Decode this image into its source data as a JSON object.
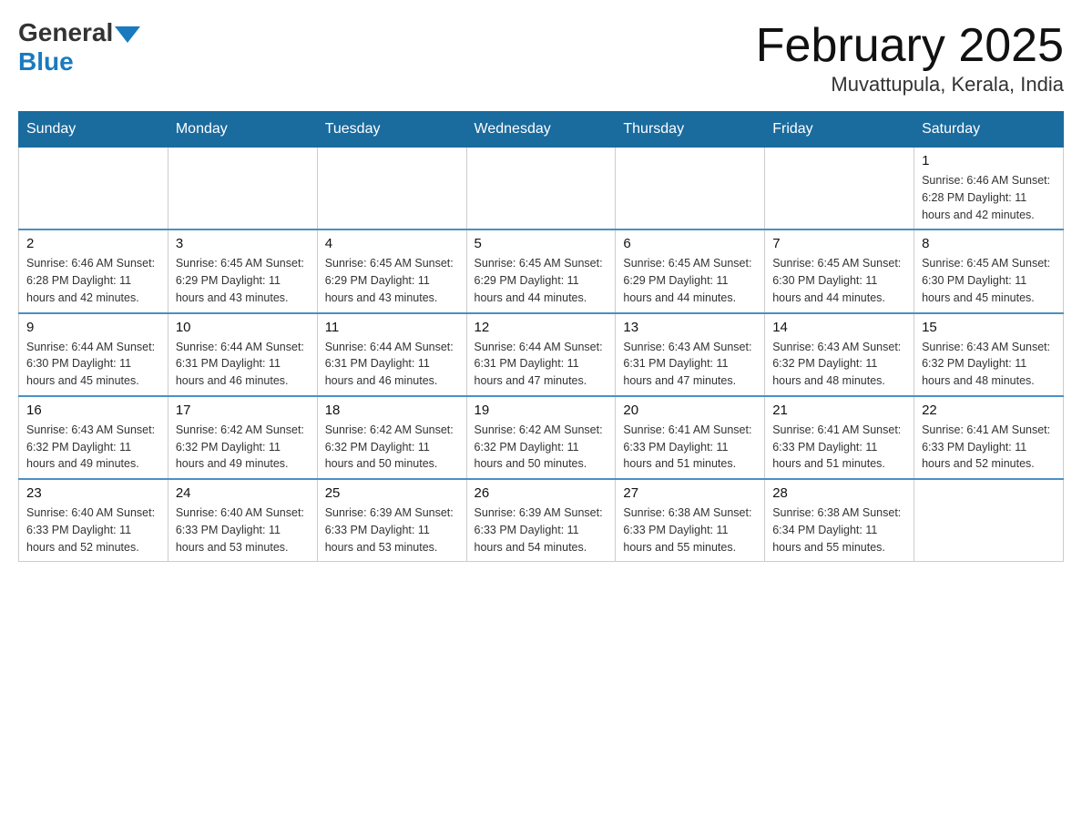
{
  "header": {
    "logo_general": "General",
    "logo_blue": "Blue",
    "month_title": "February 2025",
    "location": "Muvattupula, Kerala, India"
  },
  "days_of_week": [
    "Sunday",
    "Monday",
    "Tuesday",
    "Wednesday",
    "Thursday",
    "Friday",
    "Saturday"
  ],
  "weeks": [
    [
      {
        "day": "",
        "info": ""
      },
      {
        "day": "",
        "info": ""
      },
      {
        "day": "",
        "info": ""
      },
      {
        "day": "",
        "info": ""
      },
      {
        "day": "",
        "info": ""
      },
      {
        "day": "",
        "info": ""
      },
      {
        "day": "1",
        "info": "Sunrise: 6:46 AM\nSunset: 6:28 PM\nDaylight: 11 hours and 42 minutes."
      }
    ],
    [
      {
        "day": "2",
        "info": "Sunrise: 6:46 AM\nSunset: 6:28 PM\nDaylight: 11 hours and 42 minutes."
      },
      {
        "day": "3",
        "info": "Sunrise: 6:45 AM\nSunset: 6:29 PM\nDaylight: 11 hours and 43 minutes."
      },
      {
        "day": "4",
        "info": "Sunrise: 6:45 AM\nSunset: 6:29 PM\nDaylight: 11 hours and 43 minutes."
      },
      {
        "day": "5",
        "info": "Sunrise: 6:45 AM\nSunset: 6:29 PM\nDaylight: 11 hours and 44 minutes."
      },
      {
        "day": "6",
        "info": "Sunrise: 6:45 AM\nSunset: 6:29 PM\nDaylight: 11 hours and 44 minutes."
      },
      {
        "day": "7",
        "info": "Sunrise: 6:45 AM\nSunset: 6:30 PM\nDaylight: 11 hours and 44 minutes."
      },
      {
        "day": "8",
        "info": "Sunrise: 6:45 AM\nSunset: 6:30 PM\nDaylight: 11 hours and 45 minutes."
      }
    ],
    [
      {
        "day": "9",
        "info": "Sunrise: 6:44 AM\nSunset: 6:30 PM\nDaylight: 11 hours and 45 minutes."
      },
      {
        "day": "10",
        "info": "Sunrise: 6:44 AM\nSunset: 6:31 PM\nDaylight: 11 hours and 46 minutes."
      },
      {
        "day": "11",
        "info": "Sunrise: 6:44 AM\nSunset: 6:31 PM\nDaylight: 11 hours and 46 minutes."
      },
      {
        "day": "12",
        "info": "Sunrise: 6:44 AM\nSunset: 6:31 PM\nDaylight: 11 hours and 47 minutes."
      },
      {
        "day": "13",
        "info": "Sunrise: 6:43 AM\nSunset: 6:31 PM\nDaylight: 11 hours and 47 minutes."
      },
      {
        "day": "14",
        "info": "Sunrise: 6:43 AM\nSunset: 6:32 PM\nDaylight: 11 hours and 48 minutes."
      },
      {
        "day": "15",
        "info": "Sunrise: 6:43 AM\nSunset: 6:32 PM\nDaylight: 11 hours and 48 minutes."
      }
    ],
    [
      {
        "day": "16",
        "info": "Sunrise: 6:43 AM\nSunset: 6:32 PM\nDaylight: 11 hours and 49 minutes."
      },
      {
        "day": "17",
        "info": "Sunrise: 6:42 AM\nSunset: 6:32 PM\nDaylight: 11 hours and 49 minutes."
      },
      {
        "day": "18",
        "info": "Sunrise: 6:42 AM\nSunset: 6:32 PM\nDaylight: 11 hours and 50 minutes."
      },
      {
        "day": "19",
        "info": "Sunrise: 6:42 AM\nSunset: 6:32 PM\nDaylight: 11 hours and 50 minutes."
      },
      {
        "day": "20",
        "info": "Sunrise: 6:41 AM\nSunset: 6:33 PM\nDaylight: 11 hours and 51 minutes."
      },
      {
        "day": "21",
        "info": "Sunrise: 6:41 AM\nSunset: 6:33 PM\nDaylight: 11 hours and 51 minutes."
      },
      {
        "day": "22",
        "info": "Sunrise: 6:41 AM\nSunset: 6:33 PM\nDaylight: 11 hours and 52 minutes."
      }
    ],
    [
      {
        "day": "23",
        "info": "Sunrise: 6:40 AM\nSunset: 6:33 PM\nDaylight: 11 hours and 52 minutes."
      },
      {
        "day": "24",
        "info": "Sunrise: 6:40 AM\nSunset: 6:33 PM\nDaylight: 11 hours and 53 minutes."
      },
      {
        "day": "25",
        "info": "Sunrise: 6:39 AM\nSunset: 6:33 PM\nDaylight: 11 hours and 53 minutes."
      },
      {
        "day": "26",
        "info": "Sunrise: 6:39 AM\nSunset: 6:33 PM\nDaylight: 11 hours and 54 minutes."
      },
      {
        "day": "27",
        "info": "Sunrise: 6:38 AM\nSunset: 6:33 PM\nDaylight: 11 hours and 55 minutes."
      },
      {
        "day": "28",
        "info": "Sunrise: 6:38 AM\nSunset: 6:34 PM\nDaylight: 11 hours and 55 minutes."
      },
      {
        "day": "",
        "info": ""
      }
    ]
  ]
}
